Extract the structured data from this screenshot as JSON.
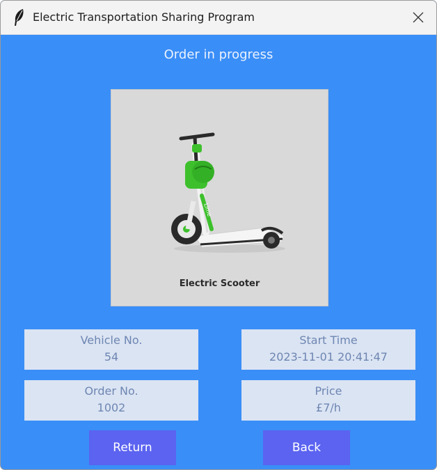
{
  "window": {
    "title": "Electric Transportation Sharing Program",
    "icons": {
      "app": "feather-icon",
      "close": "close-icon"
    }
  },
  "heading": "Order in progress",
  "vehicle_image": {
    "caption": "Electric Scooter",
    "brand_text": "Lime",
    "icon": "scooter-illustration"
  },
  "info": {
    "vehicle_no": {
      "label": "Vehicle No.",
      "value": "54"
    },
    "start_time": {
      "label": "Start Time",
      "value": "2023-11-01 20:41:47"
    },
    "order_no": {
      "label": "Order No.",
      "value": "1002"
    },
    "price": {
      "label": "Price",
      "value": "£7/h"
    }
  },
  "buttons": {
    "return_label": "Return",
    "back_label": "Back"
  },
  "colors": {
    "window_background": "#3a8ef7",
    "info_box": "#dbe4f3",
    "info_text": "#6e86b2",
    "button": "#5b63f0",
    "scooter_accent": "#3ec02d"
  }
}
